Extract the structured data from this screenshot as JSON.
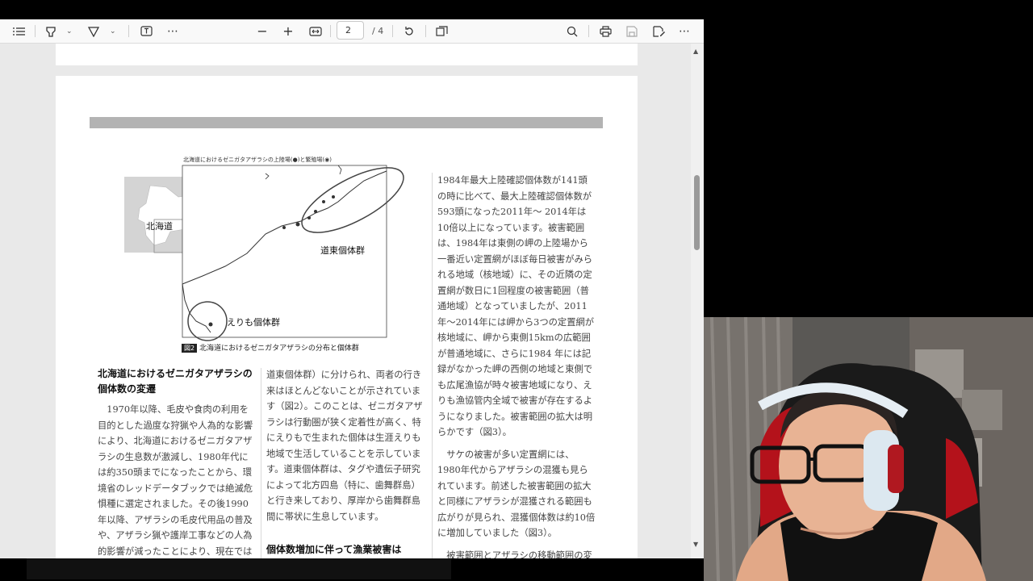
{
  "toolbar": {
    "page_current": "2",
    "page_total": "/ 4"
  },
  "map": {
    "title": "北海道におけるゼニガタアザラシの上陸場(●)と繁殖場(◉)",
    "label_hokkaido": "北海道",
    "label_doto": "道東個体群",
    "label_erimo": "えりも個体群",
    "caption_badge": "図2",
    "caption_text": "北海道におけるゼニガタアザラシの分布と個体群"
  },
  "article": {
    "left_heading": "北海道におけるゼニガタアザラシの個体数の変遷",
    "left_body": "1970年以降、毛皮や食肉の利用を目的とした過度な狩猟や人為的な影響により、北海道におけるゼニガタアザラシの生息数が激減し、1980年代には約350頭までになったことから、環境省のレッドデータブックでは絶滅危惧種に選定されました。その後1990年以降、アザラシの毛皮代用品の普及や、アザラシ猟や護岸工事などの人為的影響が減ったことにより、現在では北海道沿岸",
    "mid_body": "道東個体群）に分けられ、両者の行き来はほとんどないことが示されています（図2）。このことは、ゼニガタアザラシは行動圏が狭く定着性が高く、特にえりもで生まれた個体は生涯えりも地域で生活していることを示しています。道東個体群は、タグや遺伝子研究によって北方四島（特に、歯舞群島）と行き来しており、厚岸から歯舞群島間に帯状に生息しています。",
    "mid_heading": "個体数増加に伴って漁業被害は",
    "right_p1": "1984年最大上陸確認個体数が141頭の時に比べて、最大上陸確認個体数が593頭になった2011年～ 2014年は10倍以上になっています。被害範囲は、1984年は東側の岬の上陸場から一番近い定置網がほぼ毎日被害がみられる地域（核地域）に、その近隣の定置網が数日に1回程度の被害範囲（普通地域）となっていましたが、2011年～2014年には岬から3つの定置網が核地域に、岬から東側15kmの広範囲が普通地域に、さらに1984 年には記録がなかった岬の西側の地域と東側でも広尾漁協が時々被害地域になり、えりも漁協管内全域で被害が存在するようになりました。被害範囲の拡大は明らかです（図3）。",
    "right_p2": "サケの被害が多い定置網には、1980年代からアザラシの混獲も見られています。前述した被害範囲の拡大と同様にアザラシが混獲される範囲も広がりが見られ、混獲個体数は約10倍に増加していました（図3）。",
    "right_p3": "被害範囲とアザラシの移動範囲の変化は関連しており、移動範囲も拡大し"
  }
}
